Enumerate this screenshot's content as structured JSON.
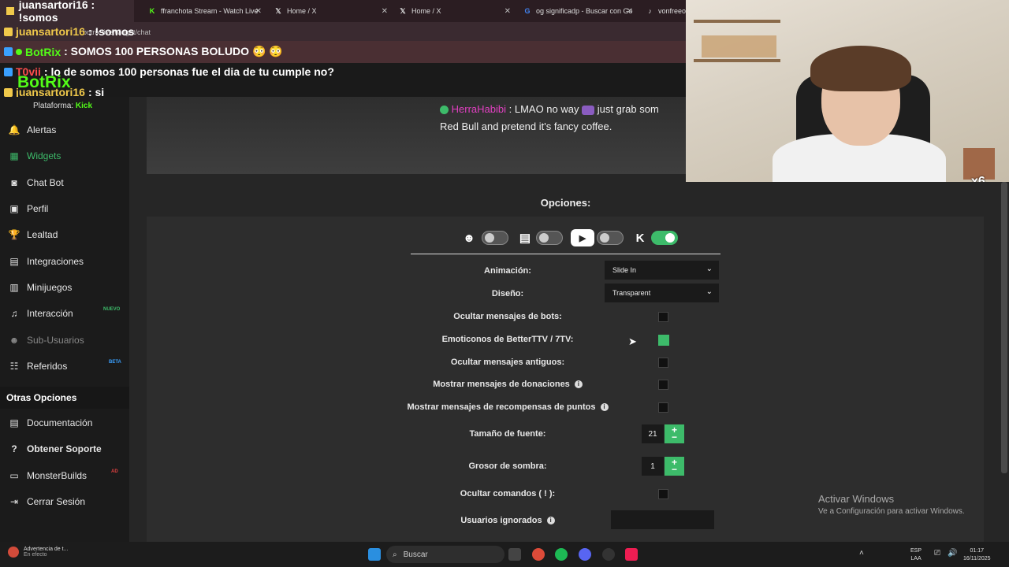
{
  "browser": {
    "tabs": [
      {
        "title": "juansartori16 : !somos",
        "icon": "user-icon"
      },
      {
        "title": "ffranchota Stream - Watch Live",
        "icon": "kick-icon"
      },
      {
        "title": "Home / X",
        "icon": "x-logo-icon"
      },
      {
        "title": "Home / X",
        "icon": "x-logo-icon"
      },
      {
        "title": "og significadp - Buscar con Go",
        "icon": "google-icon"
      },
      {
        "title": "vonfreeo",
        "icon": "tiktok-icon"
      }
    ],
    "url": "botrix.live/widget/chat"
  },
  "chat_overlay": [
    {
      "user": "juansartori16",
      "message": ": !somos",
      "user_color": "#f0c94b"
    },
    {
      "user": "BotRix",
      "message": ": SOMOS 100 PERSONAS BOLUDO 😳 😳",
      "user_color": "#53fc18"
    },
    {
      "user": "T0vii",
      "message": ": lo de somos 100 personas fue el dia de tu cumple no?",
      "user_color": "#ff4d4d"
    },
    {
      "user": "juansartori16",
      "message": ": si",
      "user_color": "#f0c94b"
    }
  ],
  "overlay_big_name": "BotRix",
  "sidebar": {
    "platform_label": "Plataforma:",
    "platform_value": "Kick",
    "items": [
      {
        "label": "Alertas",
        "icon": "bell-icon"
      },
      {
        "label": "Widgets",
        "icon": "grid-icon",
        "active": true
      },
      {
        "label": "Chat Bot",
        "icon": "robot-icon"
      },
      {
        "label": "Perfil",
        "icon": "id-card-icon"
      },
      {
        "label": "Lealtad",
        "icon": "trophy-icon"
      },
      {
        "label": "Integraciones",
        "icon": "plug-icon"
      },
      {
        "label": "Minijuegos",
        "icon": "gamepad-icon"
      },
      {
        "label": "Interacción",
        "icon": "music-icon",
        "tag": "NUEVO"
      },
      {
        "label": "Sub-Usuarios",
        "icon": "users-icon",
        "disabled": true
      },
      {
        "label": "Referidos",
        "icon": "referral-icon",
        "tag": "BETA"
      }
    ],
    "other_title": "Otras Opciones",
    "other_items": [
      {
        "label": "Documentación",
        "icon": "book-icon"
      },
      {
        "label": "Obtener Soporte",
        "icon": "question-icon"
      },
      {
        "label": "MonsterBuilds",
        "icon": "laptop-icon",
        "tag": "AD"
      },
      {
        "label": "Cerrar Sesión",
        "icon": "logout-icon"
      }
    ]
  },
  "preview": {
    "user": "HerraHabibi",
    "message_part1": ": LMAO no way",
    "message_part2": "just grab som",
    "message_line2": "Red Bull and pretend it's fancy coffee."
  },
  "options": {
    "title": "Opciones:",
    "platforms": [
      {
        "name": "botrix",
        "icon": "botrix-icon",
        "enabled": false
      },
      {
        "name": "twitch",
        "icon": "twitch-icon",
        "enabled": false
      },
      {
        "name": "youtube",
        "icon": "youtube-icon",
        "enabled": false
      },
      {
        "name": "kick",
        "icon": "kick-icon",
        "enabled": true
      }
    ],
    "animation_label": "Animación:",
    "animation_value": "Slide In",
    "design_label": "Diseño:",
    "design_value": "Transparent",
    "hide_bots_label": "Ocultar mensajes de bots:",
    "hide_bots": false,
    "bttv_label": "Emoticonos de BetterTTV / 7TV:",
    "bttv": true,
    "hide_old_label": "Ocultar mensajes antiguos:",
    "hide_old": false,
    "donations_label": "Mostrar mensajes de donaciones",
    "donations": false,
    "rewards_label": "Mostrar mensajes de recompensas de puntos",
    "rewards": false,
    "font_size_label": "Tamaño de fuente:",
    "font_size": "21",
    "shadow_label": "Grosor de sombra:",
    "shadow": "1",
    "hide_commands_label": "Ocultar comandos ( ! ):",
    "hide_commands": false,
    "ignored_label": "Usuarios ignorados",
    "ignored_value": ""
  },
  "watermark": {
    "title": "Activar Windows",
    "subtitle": "Ve a Configuración para activar Windows."
  },
  "webcam": {
    "emote_count": "x6"
  },
  "taskbar": {
    "notification_title": "Advertencia de t...",
    "notification_sub": "En efecto",
    "search_placeholder": "Buscar",
    "lang_top": "ESP",
    "lang_bottom": "LAA",
    "time": "01:17",
    "date": "16/11/2025"
  },
  "colors": {
    "accent": "#3dbb6a",
    "kick": "#53fc18"
  }
}
